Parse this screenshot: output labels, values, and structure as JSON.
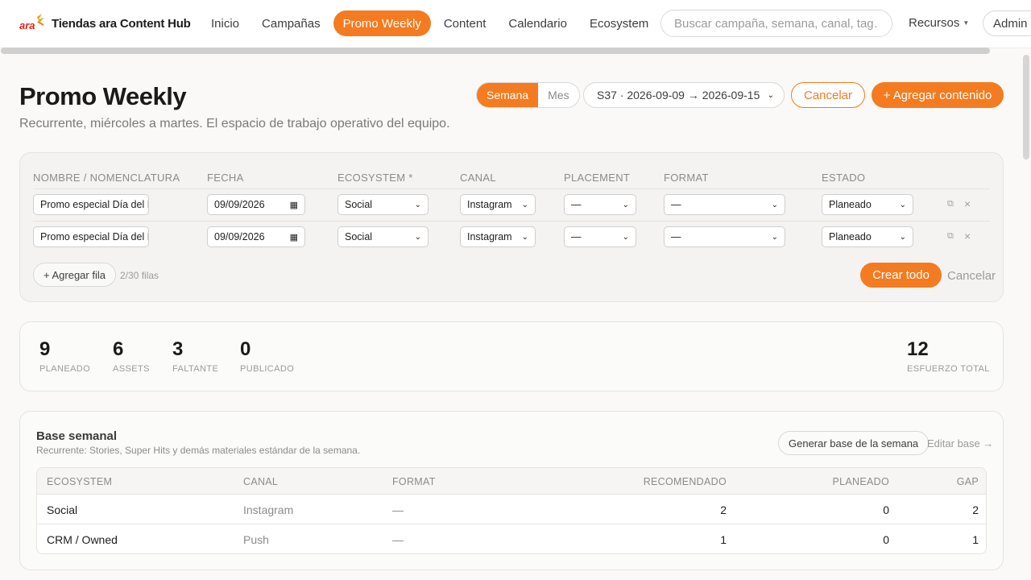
{
  "brand": {
    "logo_text": "ara",
    "title": "Tiendas ara Content Hub"
  },
  "nav": [
    {
      "label": "Inicio",
      "active": false
    },
    {
      "label": "Campañas",
      "active": false
    },
    {
      "label": "Promo Weekly",
      "active": true
    },
    {
      "label": "Content",
      "active": false
    },
    {
      "label": "Calendario",
      "active": false
    },
    {
      "label": "Ecosystem",
      "active": false
    }
  ],
  "search": {
    "placeholder": "Buscar campaña, semana, canal, tag…"
  },
  "resources": {
    "label": "Recursos"
  },
  "admin": {
    "label": "Admin"
  },
  "colors": {
    "accent": "#f47b20"
  },
  "header": {
    "title": "Promo Weekly",
    "subtitle": "Recurrente, miércoles a martes. El espacio de trabajo operativo del equipo.",
    "view_toggle": [
      "Semana",
      "Mes"
    ],
    "view_active": "Semana",
    "week_select": "S37 · 2026-09-09 → 2026-09-15",
    "cancel_label": "Cancelar",
    "add_label": "+ Agregar contenido"
  },
  "form": {
    "columns": [
      "NOMBRE / NOMENCLATURA",
      "FECHA",
      "ECOSYSTEM *",
      "CANAL",
      "PLACEMENT",
      "FORMAT",
      "ESTADO"
    ],
    "rows": [
      {
        "name": "Promo especial Día del F",
        "date": "09/09/2026",
        "ecosystem": "Social",
        "channel": "Instagram",
        "placement": "—",
        "format": "—",
        "status": "Planeado"
      },
      {
        "name": "Promo especial Día del F",
        "date": "09/09/2026",
        "ecosystem": "Social",
        "channel": "Instagram",
        "placement": "—",
        "format": "—",
        "status": "Planeado"
      }
    ],
    "add_row_label": "+ Agregar fila",
    "rows_count": "2/30 filas",
    "create_label": "Crear todo",
    "cancel_label": "Cancelar"
  },
  "stats": [
    {
      "value": "9",
      "label": "PLANEADO"
    },
    {
      "value": "6",
      "label": "ASSETS"
    },
    {
      "value": "3",
      "label": "FALTANTE"
    },
    {
      "value": "0",
      "label": "PUBLICADO"
    },
    {
      "value": "12",
      "label": "ESFUERZO TOTAL"
    }
  ],
  "base": {
    "title": "Base semanal",
    "subtitle": "Recurrente: Stories, Super Hits y demás materiales estándar de la semana.",
    "generate_label": "Generar base de la semana",
    "edit_label": "Editar base →",
    "columns": [
      "ECOSYSTEM",
      "CANAL",
      "FORMAT",
      "RECOMENDADO",
      "PLANEADO",
      "GAP"
    ],
    "rows": [
      {
        "ecosystem": "Social",
        "channel": "Instagram",
        "format": "—",
        "recommended": "2",
        "planned": "0",
        "gap": "2"
      },
      {
        "ecosystem": "CRM / Owned",
        "channel": "Push",
        "format": "—",
        "recommended": "1",
        "planned": "0",
        "gap": "1"
      }
    ]
  }
}
